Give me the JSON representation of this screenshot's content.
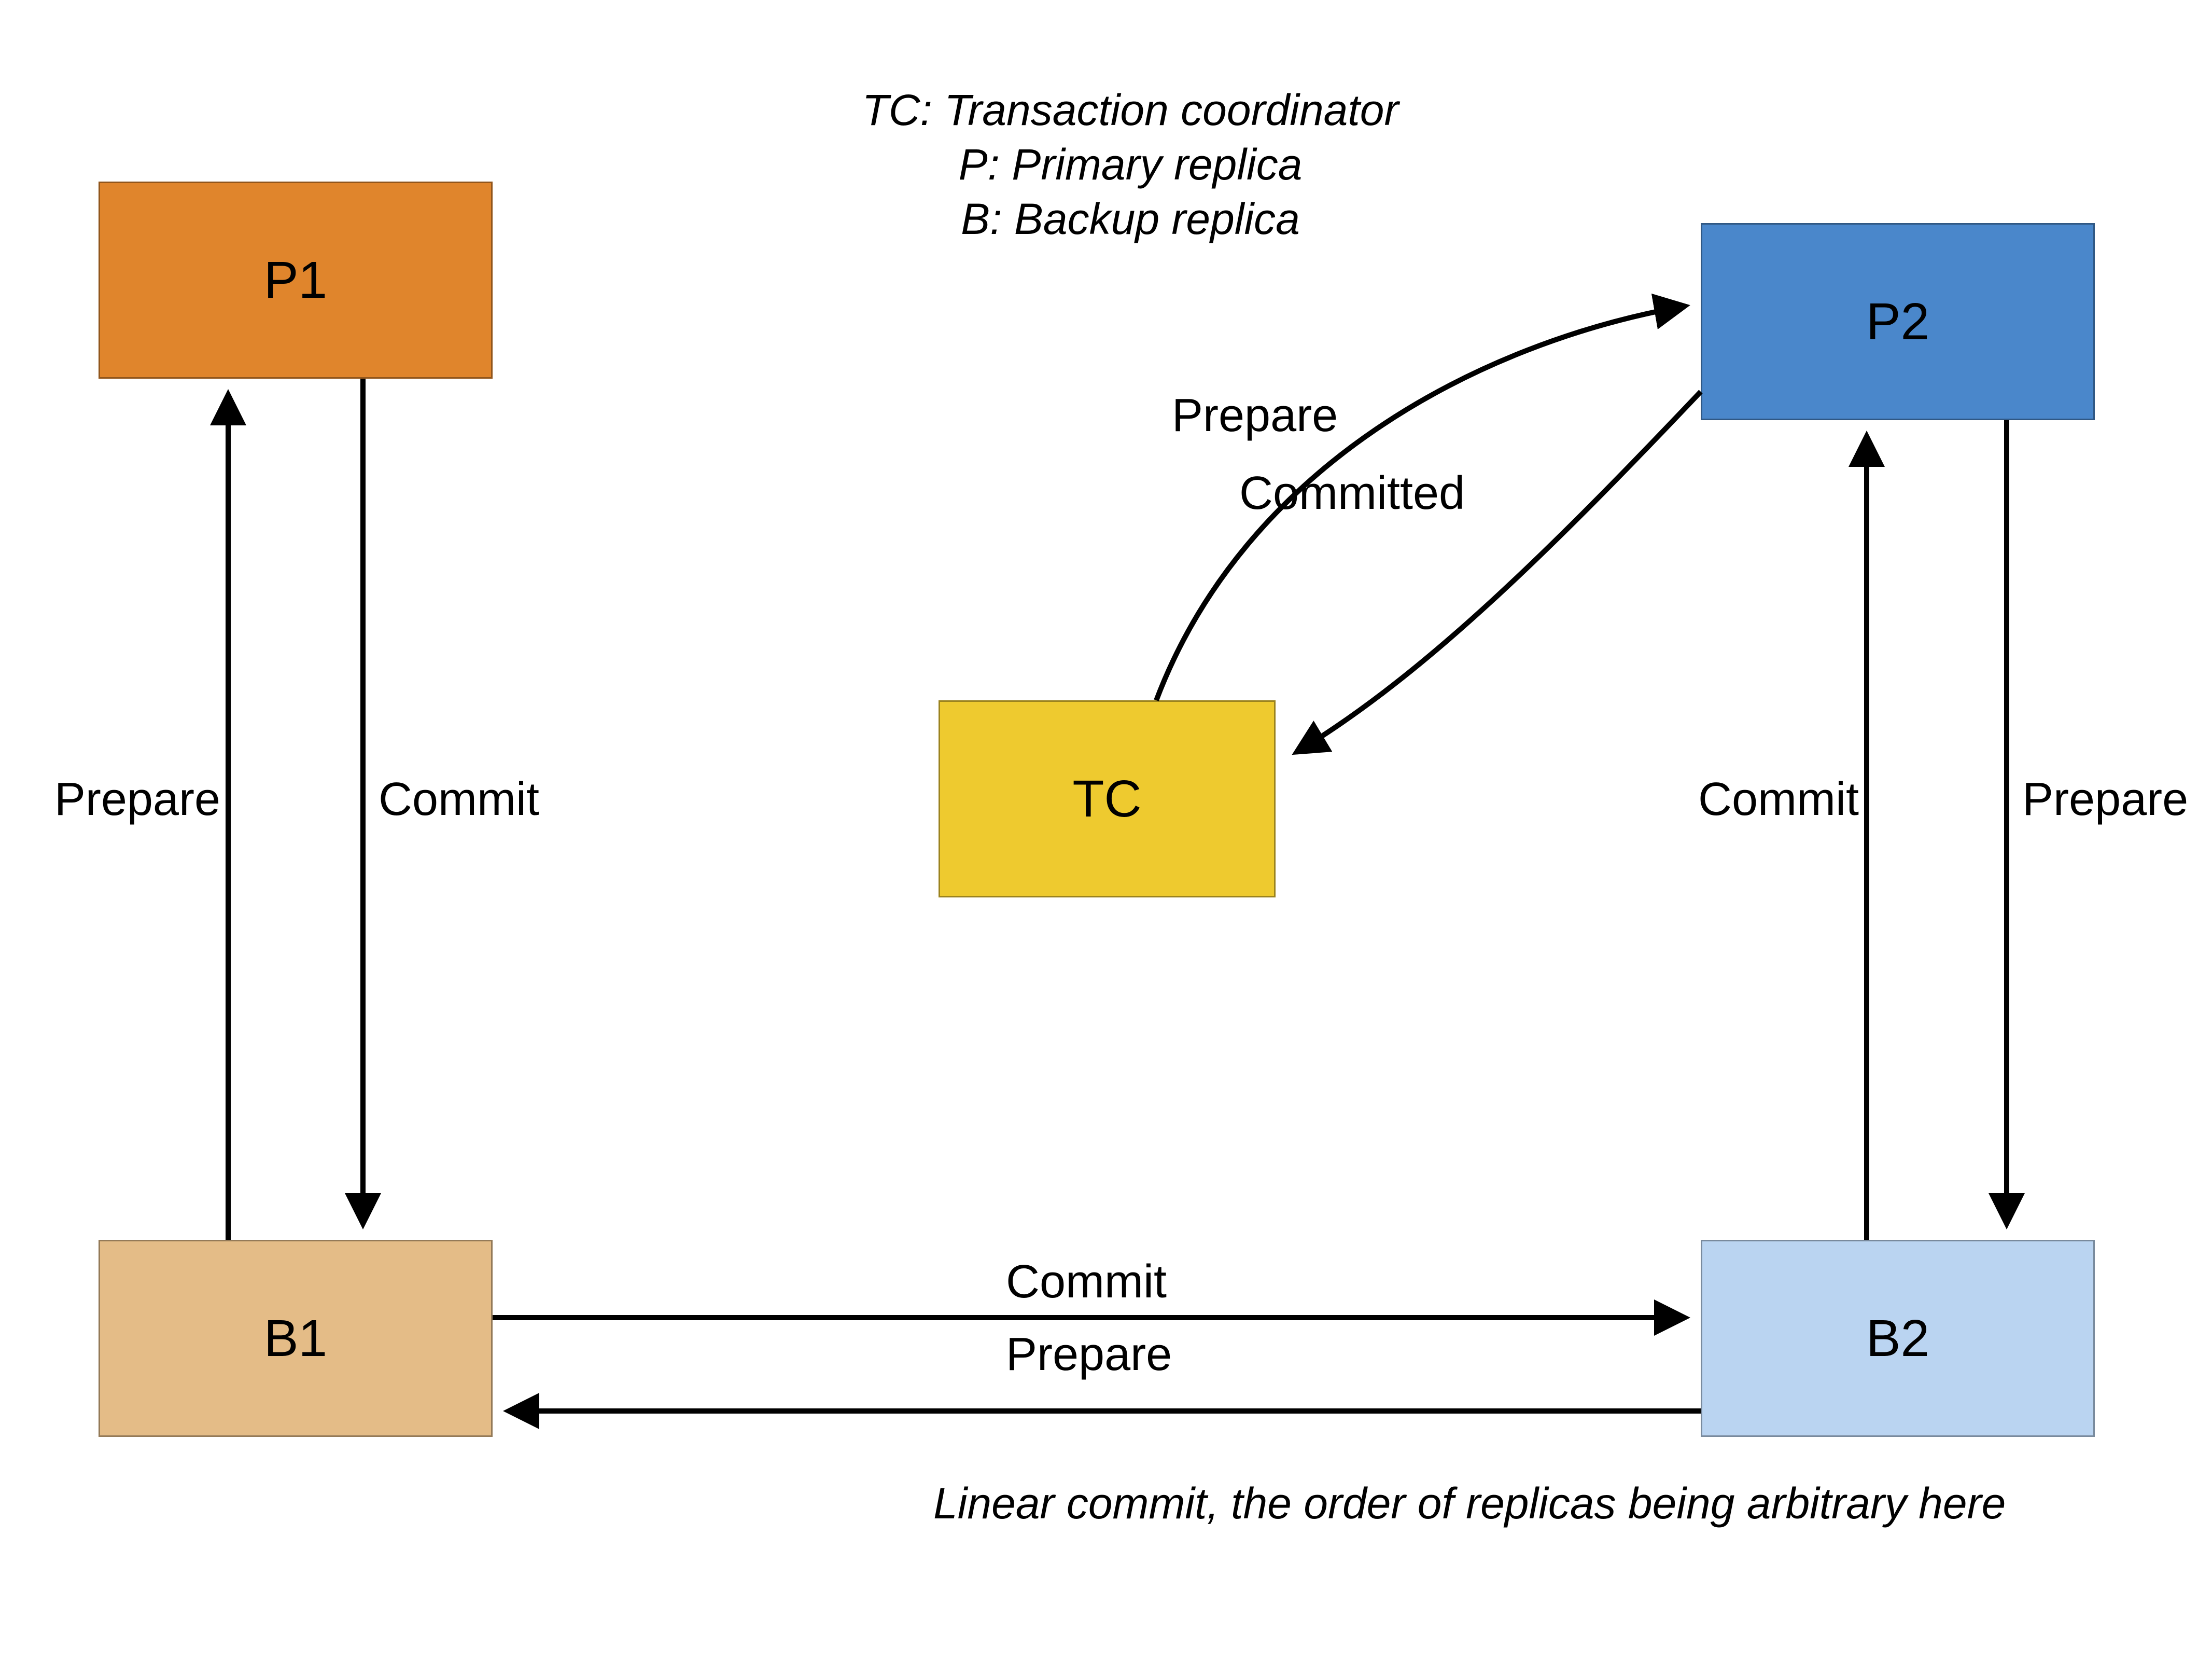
{
  "legend": {
    "line1": "TC: Transaction coordinator",
    "line2": "P: Primary replica",
    "line3": "B: Backup replica"
  },
  "nodes": {
    "p1": {
      "label": "P1",
      "color": "#E0852C"
    },
    "p2": {
      "label": "P2",
      "color": "#4A87CB"
    },
    "b1": {
      "label": "B1",
      "color": "#E4BC87"
    },
    "b2": {
      "label": "B2",
      "color": "#BAD4F1"
    },
    "tc": {
      "label": "TC",
      "color": "#EECA2F"
    }
  },
  "edges": {
    "p1_b1_prepare": "Prepare",
    "p1_b1_commit": "Commit",
    "p2_b2_commit": "Commit",
    "p2_b2_prepare": "Prepare",
    "b1_b2_commit": "Commit",
    "b1_b2_prepare": "Prepare",
    "tc_p2_prepare": "Prepare",
    "tc_p2_committed": "Committed"
  },
  "caption": "Linear commit, the order of replicas being arbitrary here"
}
